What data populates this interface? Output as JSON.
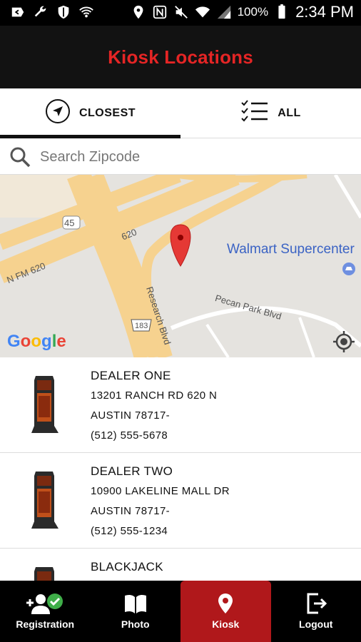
{
  "status_bar": {
    "battery_percent": "100%",
    "time": "2:34 PM",
    "icons_left": [
      "back-arrow-icon",
      "wrench-icon",
      "shield-icon",
      "wifi-hotspot-icon"
    ],
    "icons_right": [
      "location-pin-icon",
      "nfc-icon",
      "mute-icon",
      "wifi-icon",
      "signal-icon",
      "battery-icon"
    ]
  },
  "header": {
    "title": "Kiosk Locations",
    "title_color": "#e52525"
  },
  "tabs": [
    {
      "label": "CLOSEST",
      "icon": "navigation-arrow-icon",
      "active": true
    },
    {
      "label": "ALL",
      "icon": "checklist-icon",
      "active": false
    }
  ],
  "search": {
    "placeholder": "Search Zipcode",
    "value": ""
  },
  "map": {
    "poi": "Walmart Supercenter",
    "roads": [
      "620",
      "N FM 620",
      "45",
      "Research Blvd",
      "183",
      "Pecan Park Blvd"
    ],
    "logo": [
      "G",
      "o",
      "o",
      "g",
      "l",
      "e"
    ]
  },
  "dealers": [
    {
      "name": "DEALER ONE",
      "address": "13201 RANCH RD 620 N",
      "city": "AUSTIN 78717-",
      "phone": "(512) 555-5678"
    },
    {
      "name": "DEALER TWO",
      "address": "10900 LAKELINE MALL DR",
      "city": "AUSTIN 78717-",
      "phone": "(512) 555-1234"
    },
    {
      "name": "BLACKJACK",
      "address": "",
      "city": "",
      "phone": ""
    }
  ],
  "bottom_nav": [
    {
      "label": "Registration",
      "icon": "add-user-check-icon",
      "active": false
    },
    {
      "label": "Photo",
      "icon": "open-book-icon",
      "active": false
    },
    {
      "label": "Kiosk",
      "icon": "location-pin-icon",
      "active": true
    },
    {
      "label": "Logout",
      "icon": "logout-icon",
      "active": false
    }
  ],
  "colors": {
    "accent": "#b0181b",
    "header_bg": "#121212",
    "map_bg": "#e5e3df",
    "road": "#f6d28f"
  }
}
